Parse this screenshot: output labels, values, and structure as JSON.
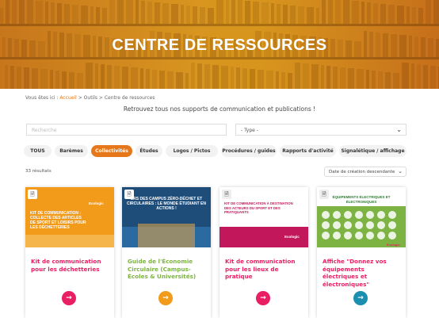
{
  "hero": {
    "title": "CENTRE DE RESSOURCES"
  },
  "breadcrumb": {
    "prefix": "Vous êtes ici : ",
    "home": "Accueil",
    "rest": " > Outils > Centre de ressources"
  },
  "intro": "Retrouvez tous nos supports de communication et publications !",
  "search": {
    "placeholder": "Recherche"
  },
  "type_select": {
    "value": "- Type -"
  },
  "filters": [
    {
      "label": "TOUS",
      "active": false
    },
    {
      "label": "Barèmes",
      "active": false
    },
    {
      "label": "Collectivités",
      "active": true
    },
    {
      "label": "Études",
      "active": false
    },
    {
      "label": "Logos / Pictos",
      "active": false
    },
    {
      "label": "Procédures / guides",
      "active": false
    },
    {
      "label": "Rapports d'activité",
      "active": false
    },
    {
      "label": "Signalétique / affichage",
      "active": false
    }
  ],
  "results_count": "33 résultats",
  "sort": {
    "value": "Date de création descendante"
  },
  "cards": [
    {
      "title": "Kit de communication pour les déchetteries",
      "color": "#e91e63",
      "thumb_text": "KIT DE COMMUNICATION : COLLECTE DES ARTICLES DE SPORT ET LOISIRS POUR LES DÉCHETTERIES",
      "thumb_brand": "Ecologic"
    },
    {
      "title": "Guide de l'Économie Circulaire (Campus-Écoles & Universités)",
      "color": "#7cb342",
      "thumb_text": "ERS DES CAMPUS ZÉRO-DÉCHET ET CIRCULAIRES : LE MONDE ÉTUDIANT EN ACTIONS !",
      "thumb_brand": ""
    },
    {
      "title": "Kit de communication pour les lieux de pratique",
      "color": "#e91e63",
      "thumb_text": "KIT DE COMMUNICATION À DESTINATION DES ACTEURS DU SPORT ET DES PRATIQUANTS",
      "thumb_brand": "Ecologic"
    },
    {
      "title": "Affiche \"Donnez vos équipements électriques et électroniques\"",
      "color": "#1a8fb0",
      "thumb_text": "ÉQUIPEMENTS ÉLECTRIQUES ET ÉLECTRONIQUES",
      "thumb_brand": "Ecologic"
    }
  ],
  "colors": {
    "accent": "#e6771a",
    "pink": "#e91e63",
    "green": "#7cb342",
    "blue": "#1a8fb0"
  },
  "icons": {
    "document": "document-icon",
    "arrow": "arrow-right-icon",
    "chevron": "chevron-down-icon"
  }
}
